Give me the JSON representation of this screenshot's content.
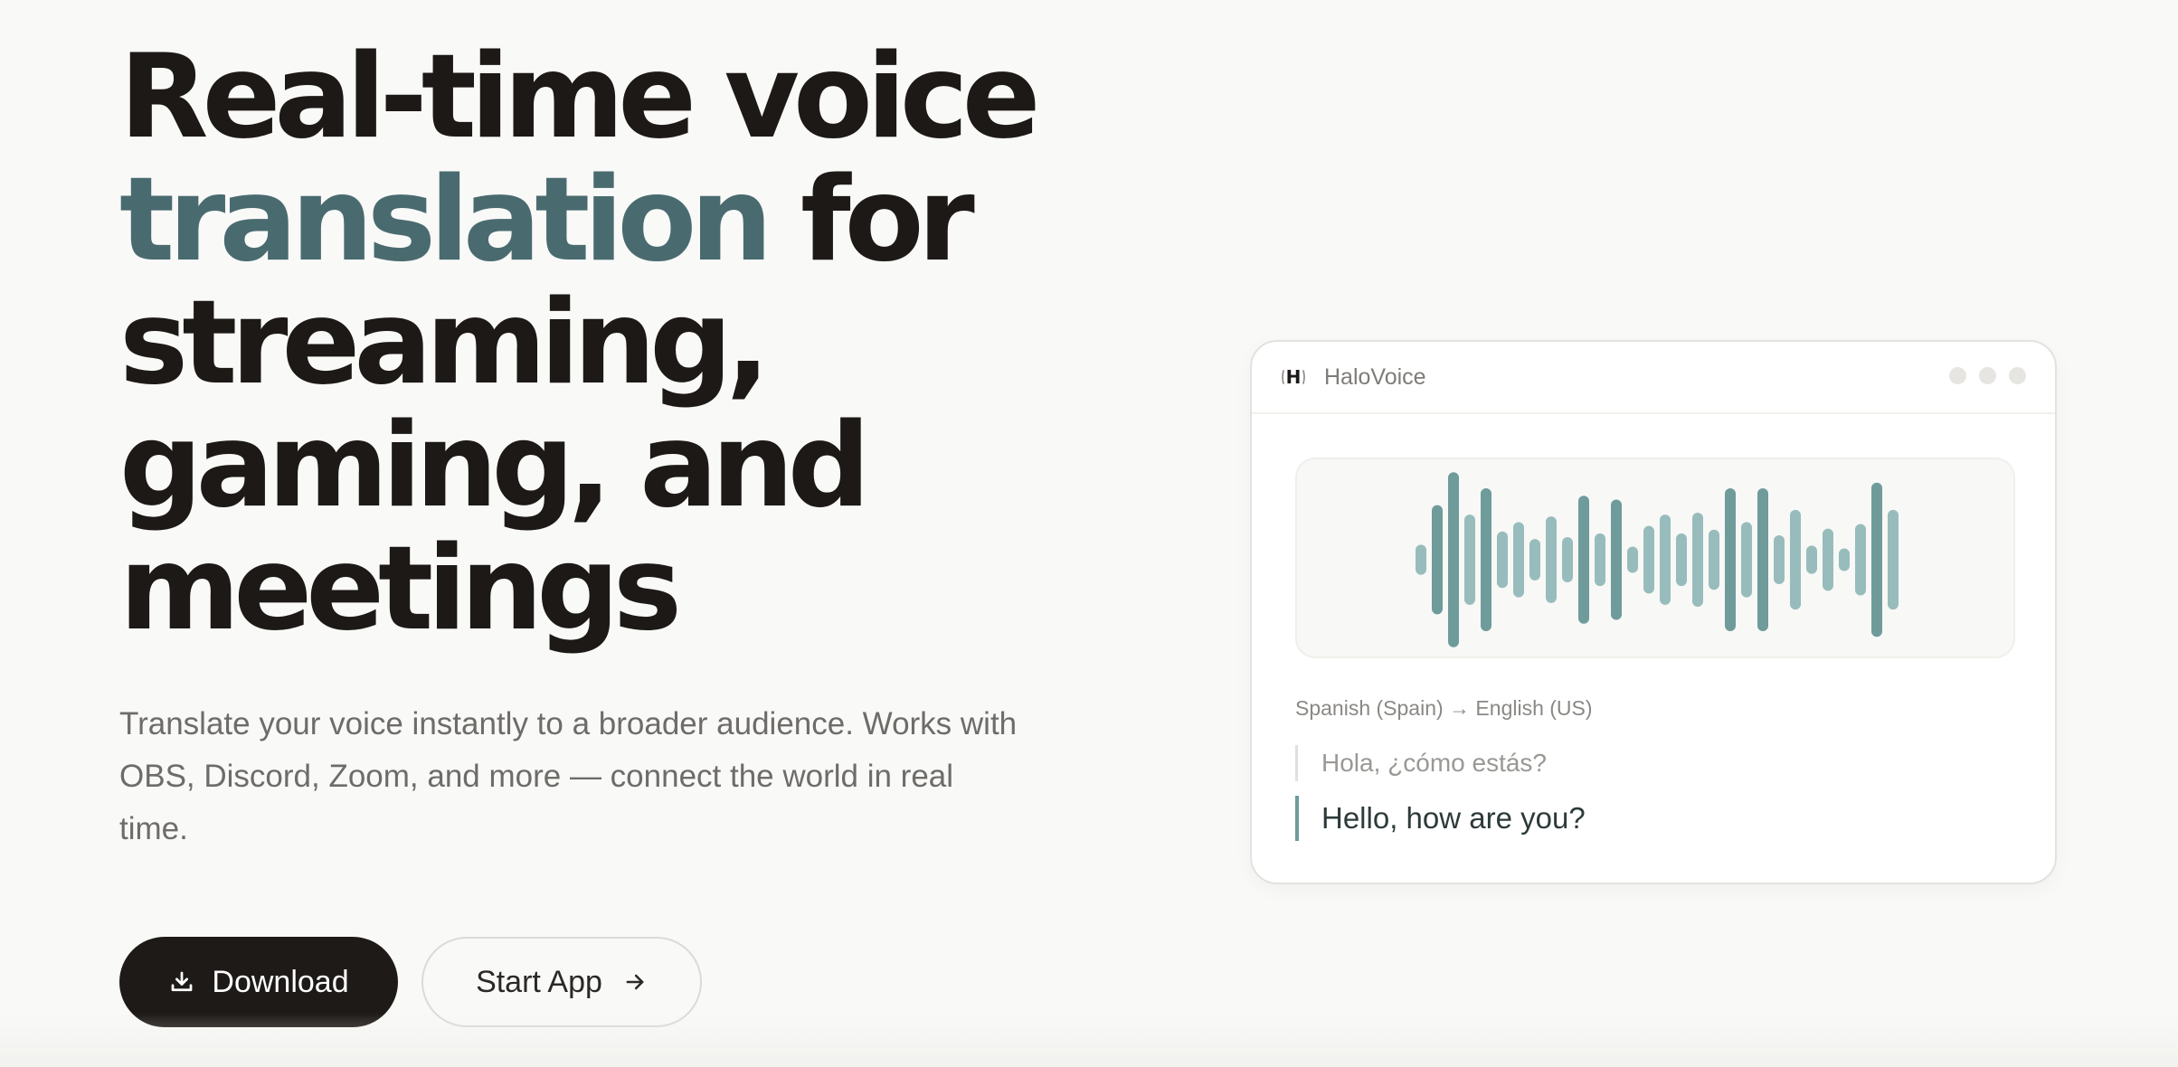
{
  "hero": {
    "title_line1": "Real-time voice",
    "title_accent": "translation",
    "title_line2_rest": " for",
    "title_line3": "streaming,",
    "title_line4": "gaming, and",
    "title_line5": "meetings",
    "subtitle": "Translate your voice instantly to a broader audience. Works with OBS, Discord, Zoom, and more — connect the world in real time.",
    "accent_color": "#496b70"
  },
  "actions": {
    "download_label": "Download",
    "start_app_label": "Start App",
    "download_icon": "download-icon",
    "start_app_icon": "arrow-right-icon"
  },
  "app_preview": {
    "app_name": "HaloVoice",
    "logo_letter": "H",
    "language_pair": "Spanish (Spain) → English (US)",
    "source_text": "Hola, ¿cómo estás?",
    "translated_text": "Hello, how are you?",
    "waveform": {
      "bar_color_dark": "#6f9b9b",
      "bar_color_light": "#98bcbc",
      "levels": [
        0.16,
        0.58,
        0.93,
        0.48,
        0.76,
        0.3,
        0.4,
        0.22,
        0.46,
        0.24,
        0.68,
        0.28,
        0.64,
        0.14,
        0.36,
        0.48,
        0.28,
        0.5,
        0.32,
        0.76,
        0.4,
        0.76,
        0.26,
        0.53,
        0.15,
        0.33,
        0.12,
        0.38,
        0.82,
        0.53
      ]
    }
  }
}
